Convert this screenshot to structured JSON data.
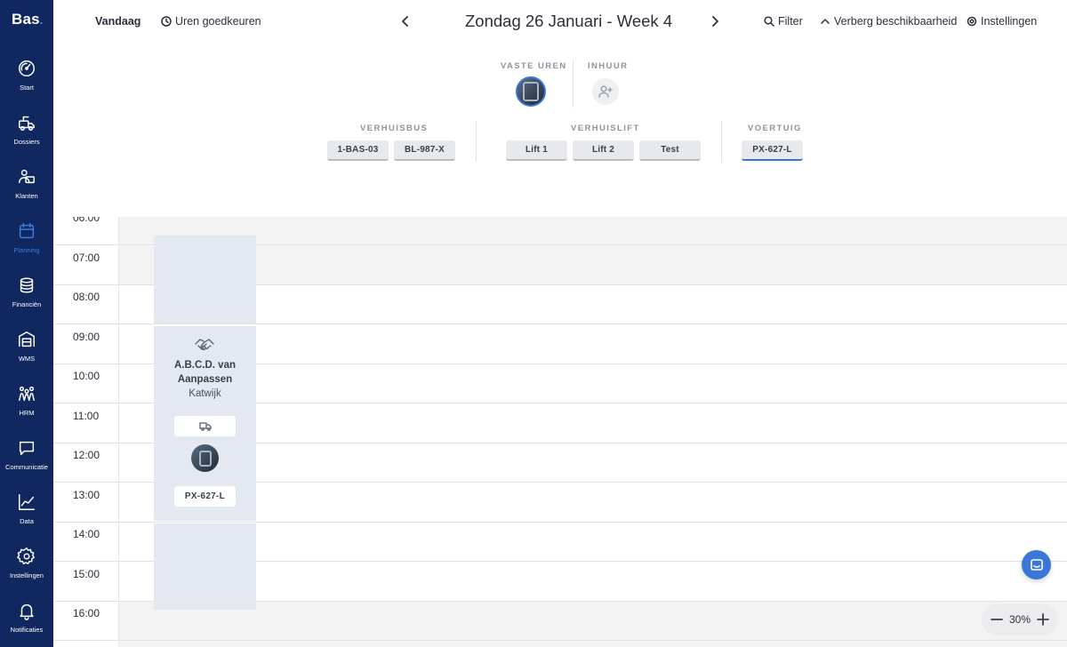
{
  "app": {
    "logo": "Bas",
    "logo_dot": "."
  },
  "sidebar": {
    "items": [
      {
        "label": "Start",
        "icon": "dashboard-icon"
      },
      {
        "label": "Dossiers",
        "icon": "dossiers-icon"
      },
      {
        "label": "Klanten",
        "icon": "customers-icon"
      },
      {
        "label": "Planning",
        "icon": "calendar-icon",
        "active": true
      },
      {
        "label": "Financiën",
        "icon": "coins-icon"
      },
      {
        "label": "WMS",
        "icon": "warehouse-icon"
      },
      {
        "label": "HRM",
        "icon": "people-icon"
      },
      {
        "label": "Communicatie",
        "icon": "chat-icon"
      },
      {
        "label": "Data",
        "icon": "chart-icon"
      },
      {
        "label": "Instellingen",
        "icon": "gear-icon"
      },
      {
        "label": "Notificaties",
        "icon": "bell-icon"
      }
    ],
    "active_color": "#3d7bdc",
    "background": "#10285f"
  },
  "topbar": {
    "today": "Vandaag",
    "approve_hours": "Uren goedkeuren",
    "date_title": "Zondag 26 Januari - Week 4",
    "filter": "Filter",
    "hide_availability": "Verberg beschikbaarheid",
    "settings": "Instellingen"
  },
  "resources": {
    "fixed_hours_label": "VASTE UREN",
    "hire_label": "INHUUR",
    "moving_van": {
      "label": "VERHUISBUS",
      "chips": [
        "1-BAS-03",
        "BL-987-X"
      ]
    },
    "moving_lift": {
      "label": "VERHUISLIFT",
      "chips": [
        "Lift 1",
        "Lift 2",
        "Test"
      ]
    },
    "vehicle": {
      "label": "VOERTUIG",
      "chips": [
        "PX-627-L"
      ]
    }
  },
  "calendar": {
    "hours": [
      "06:00",
      "07:00",
      "08:00",
      "09:00",
      "10:00",
      "11:00",
      "12:00",
      "13:00",
      "14:00",
      "15:00",
      "16:00"
    ],
    "job": {
      "icon": "handshake-icon",
      "title_line1": "A.B.C.D. van",
      "title_line2": "Aanpassen",
      "city": "Katwijk",
      "vehicle": "PX-627-L"
    }
  },
  "zoom": {
    "value": "30%"
  },
  "colors": {
    "accent": "#3a77d8"
  }
}
